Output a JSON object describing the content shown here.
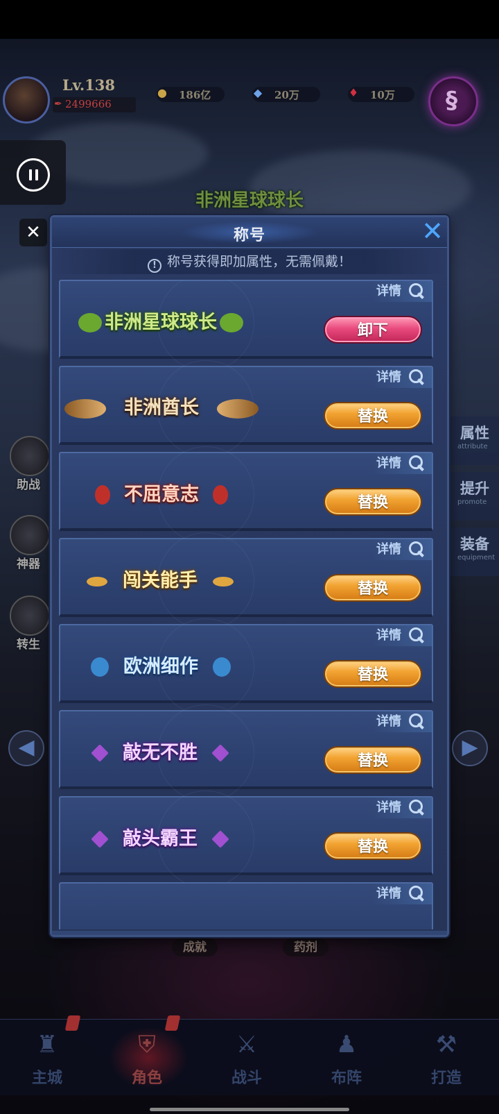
{
  "hud": {
    "level": "Lv.138",
    "power": "2499666",
    "resources": [
      {
        "icon": "gold-coin-icon",
        "value": "186亿",
        "color": "#c9a347"
      },
      {
        "icon": "diamond-icon",
        "value": "20万",
        "color": "#6ea3e8"
      },
      {
        "icon": "ruby-icon",
        "value": "10万",
        "color": "#d03040"
      }
    ]
  },
  "top_title": "非洲星球球长",
  "side_left": [
    {
      "label": "助战"
    },
    {
      "label": "神器"
    },
    {
      "label": "转生"
    }
  ],
  "side_right": [
    {
      "label": "属性",
      "sub": "attribute"
    },
    {
      "label": "提升",
      "sub": "promote"
    },
    {
      "label": "装备",
      "sub": "equipment"
    }
  ],
  "under_tabs": [
    "成就",
    "药剂"
  ],
  "bottom_nav": [
    {
      "label": "主城",
      "icon": "castle-icon",
      "active": false,
      "badge": true
    },
    {
      "label": "角色",
      "icon": "helmet-icon",
      "active": true,
      "badge": true
    },
    {
      "label": "战斗",
      "icon": "crossed-swords-icon",
      "active": false,
      "badge": false
    },
    {
      "label": "布阵",
      "icon": "formation-icon",
      "active": false,
      "badge": false
    },
    {
      "label": "打造",
      "icon": "anvil-icon",
      "active": false,
      "badge": false
    }
  ],
  "panel": {
    "title": "称号",
    "notice": "称号获得即加属性，无需佩戴！",
    "detail_label": "详情",
    "titles": [
      {
        "name": "非洲星球球长",
        "button": "卸下",
        "button_style": "pink",
        "color": "#cfe98a",
        "glow": "#2c5a12"
      },
      {
        "name": "非洲酋长",
        "button": "替换",
        "button_style": "orange",
        "color": "#f3e2c0",
        "glow": "#6b3a12"
      },
      {
        "name": "不屈意志",
        "button": "替换",
        "button_style": "orange",
        "color": "#ffd6c4",
        "glow": "#8a1a14"
      },
      {
        "name": "闯关能手",
        "button": "替换",
        "button_style": "orange",
        "color": "#fff0b0",
        "glow": "#7a4a08"
      },
      {
        "name": "欧洲细作",
        "button": "替换",
        "button_style": "orange",
        "color": "#d6ecff",
        "glow": "#1a4a8a"
      },
      {
        "name": "敲无不胜",
        "button": "替换",
        "button_style": "orange",
        "color": "#f2d6ff",
        "glow": "#5a1a8a"
      },
      {
        "name": "敲头霸王",
        "button": "替换",
        "button_style": "orange",
        "color": "#f2d6ff",
        "glow": "#5a1a8a"
      },
      {
        "name": "",
        "button": "",
        "button_style": "orange",
        "color": "#fff",
        "glow": "#000"
      }
    ]
  }
}
